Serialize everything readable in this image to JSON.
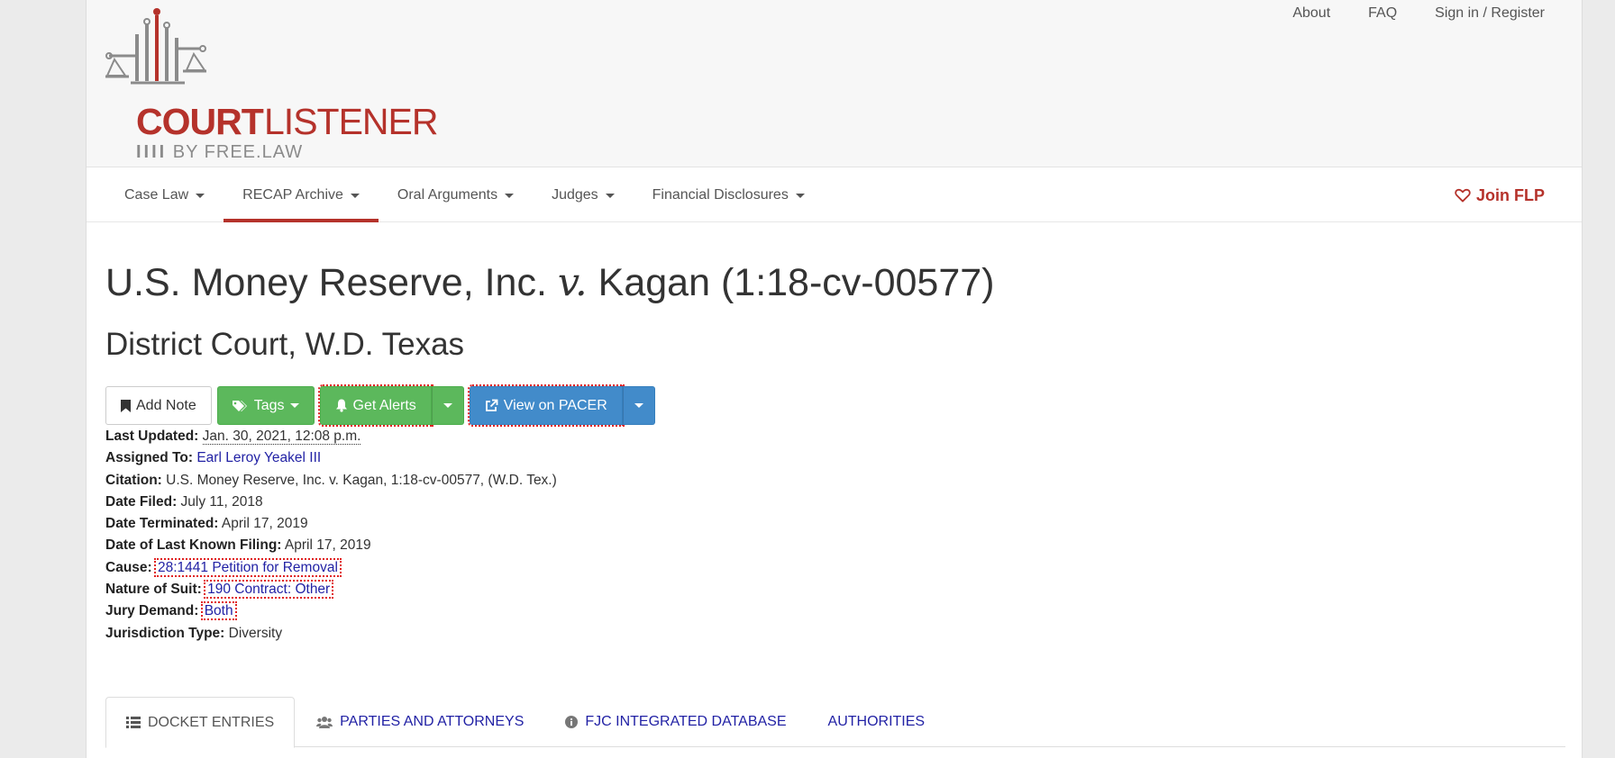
{
  "header": {
    "logo": {
      "word1": "COURT",
      "word2": "LISTENER",
      "byline": "BY FREE.LAW",
      "bars": "IIII"
    },
    "top_links": [
      "About",
      "FAQ",
      "Sign in / Register"
    ]
  },
  "nav": {
    "items": [
      {
        "label": "Case Law"
      },
      {
        "label": "RECAP Archive"
      },
      {
        "label": "Oral Arguments"
      },
      {
        "label": "Judges"
      },
      {
        "label": "Financial Disclosures"
      }
    ],
    "join_label": "Join FLP"
  },
  "case": {
    "title_left": "U.S. Money Reserve, Inc.",
    "title_v": "v.",
    "title_right": "Kagan (1:18-cv-00577)",
    "court": "District Court, W.D. Texas"
  },
  "actions": {
    "add_note": "Add Note",
    "tags": "Tags",
    "get_alerts": "Get Alerts",
    "view_pacer": "View on PACER"
  },
  "meta": [
    {
      "label": "Last Updated:",
      "value": "Jan. 30, 2021, 12:08 p.m."
    },
    {
      "label": "Assigned To:",
      "value": "Earl Leroy Yeakel III"
    },
    {
      "label": "Citation:",
      "value": "U.S. Money Reserve, Inc. v. Kagan, 1:18-cv-00577, (W.D. Tex.)"
    },
    {
      "label": "Date Filed:",
      "value": "July 11, 2018"
    },
    {
      "label": "Date Terminated:",
      "value": "April 17, 2019"
    },
    {
      "label": "Date of Last Known Filing:",
      "value": "April 17, 2019"
    },
    {
      "label": "Cause:",
      "value": "28:1441 Petition for Removal"
    },
    {
      "label": "Nature of Suit:",
      "value": "190 Contract: Other"
    },
    {
      "label": "Jury Demand:",
      "value": "Both"
    },
    {
      "label": "Jurisdiction Type:",
      "value": "Diversity"
    }
  ],
  "tabs": [
    {
      "label": "DOCKET ENTRIES",
      "icon": "list-icon"
    },
    {
      "label": "PARTIES AND ATTORNEYS",
      "icon": "users-icon"
    },
    {
      "label": "FJC INTEGRATED DATABASE",
      "icon": "info-icon"
    },
    {
      "label": "AUTHORITIES",
      "icon": ""
    }
  ],
  "colors": {
    "brand": "#b5322b",
    "link": "#2222a5",
    "green": "#5cb85c",
    "blue": "#428bca"
  }
}
